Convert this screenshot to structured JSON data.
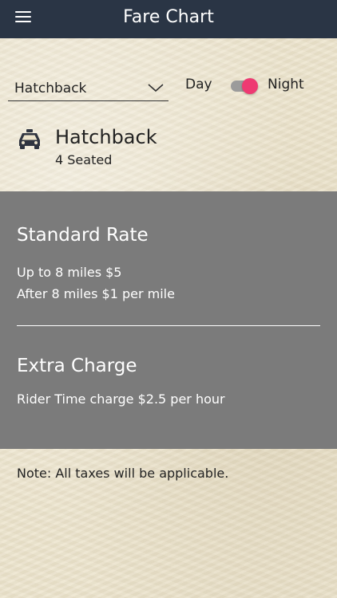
{
  "header": {
    "title": "Fare Chart",
    "menu_icon": "hamburger-menu-icon"
  },
  "controls": {
    "vehicle_select_value": "Hatchback",
    "day_label": "Day",
    "night_label": "Night",
    "night_mode_on": true,
    "toggle_color": "#ee3a72"
  },
  "vehicle": {
    "icon": "taxi-icon",
    "name": "Hatchback",
    "seats": "4 Seated"
  },
  "standard_rate": {
    "heading": "Standard Rate",
    "lines": [
      "Up to 8 miles $5",
      "After 8 miles $1 per mile"
    ]
  },
  "extra_charge": {
    "heading": "Extra Charge",
    "lines": [
      "Rider Time charge $2.5 per hour"
    ]
  },
  "note": "Note: All taxes will be applicable.",
  "colors": {
    "header_bg": "#2a3545",
    "panel_bg": "#7b7b7b",
    "page_bg": "#ece3cb"
  }
}
